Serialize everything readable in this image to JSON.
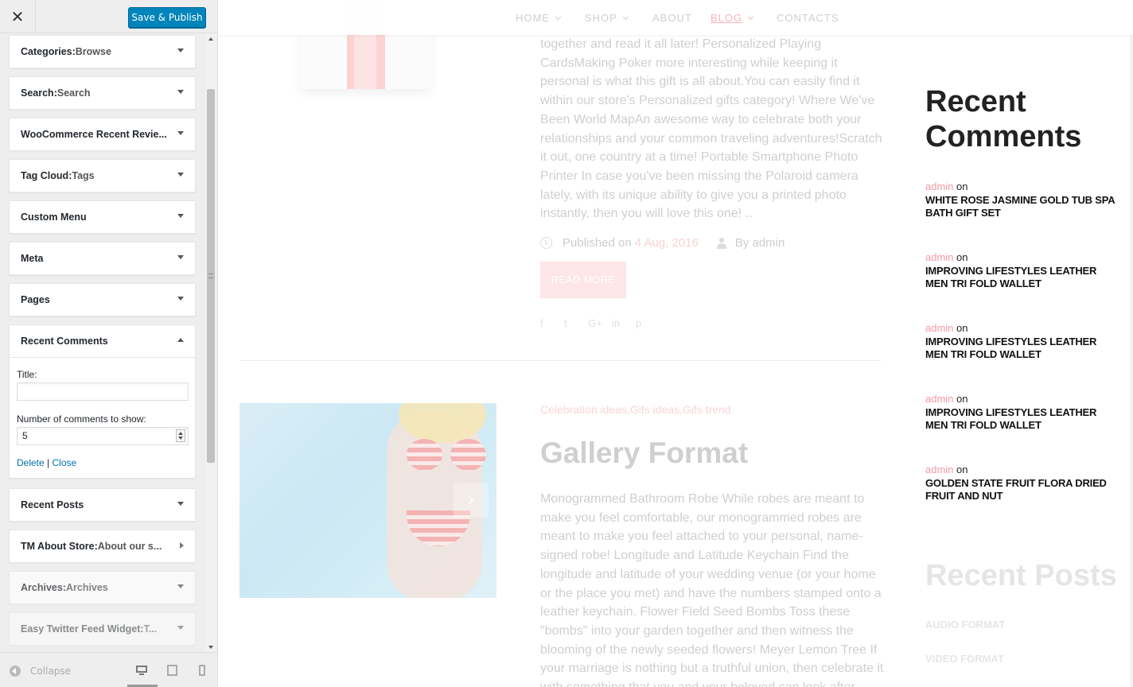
{
  "customizer": {
    "close_icon": "close-icon",
    "close_glyph": "✕",
    "save_label": "Save & Publish",
    "widgets": [
      {
        "title": "Categories",
        "sub": "Browse"
      },
      {
        "title": "Search",
        "sub": "Search"
      },
      {
        "title": "WooCommerce Recent Revie...",
        "sub": ""
      },
      {
        "title": "Tag Cloud",
        "sub": "Tags"
      },
      {
        "title": "Custom Menu",
        "sub": ""
      },
      {
        "title": "Meta",
        "sub": ""
      },
      {
        "title": "Pages",
        "sub": ""
      },
      {
        "title": "Recent Comments",
        "sub": ""
      },
      {
        "title": "Recent Posts",
        "sub": ""
      },
      {
        "title": "TM About Store",
        "sub": "About our s..."
      },
      {
        "title": "Archives",
        "sub": "Archives"
      },
      {
        "title": "Easy Twitter Feed Widget",
        "sub": "T..."
      }
    ],
    "sep": ": ",
    "expanded": {
      "title_label": "Title:",
      "title_value": "",
      "count_label": "Number of comments to show:",
      "count_value": "5",
      "delete_label": "Delete",
      "pipe": "|",
      "close_label": "Close"
    },
    "footer": {
      "collapse_label": "Collapse"
    }
  },
  "preview": {
    "nav": [
      "HOME",
      "SHOP",
      "ABOUT",
      "BLOG",
      "CONTACTS"
    ],
    "post1": {
      "excerpt": "together and read it all later! Personalized Playing CardsMaking Poker more interesting while keeping it personal is what this gift is all about.You can easily find it within our store's Personalized gifts category! Where We've Been World MapAn awesome way to celebrate both your relationships and your common traveling adventures!Scratch it out, one country at a time! Portable Smartphone Photo Printer In case you've been missing the Polaroid camera lately, with its unique ability to give you a printed photo instantly, then you will love this one! ..",
      "published_prefix": "Published on",
      "date": "4 Aug, 2016",
      "by_author": "By admin",
      "read_more": "READ MORE",
      "share": [
        "f",
        "t",
        "G+",
        "in",
        "p"
      ]
    },
    "post2": {
      "categories": "Celebration ideas,Gifs ideas,Gifs trend",
      "title": "Gallery Format",
      "excerpt": " Monogrammed Bathroom Robe While robes are meant to make you feel comfortable, our monogrammed robes are meant to make you feel attached to your personal, name-signed robe!  Longitude and Latitude Keychain Find the longitude and latitude of your wedding venue (or your home or the place you met) and have the numbers stamped onto a leather keychain.  Flower Field Seed Bombs Toss these \"bombs\" into your garden together and then witness the blooming of the newly seeded flowers!  Meyer Lemon Tree If your marriage is nothing but a truthful union, then celebrate it with something that you and your beloved can look after"
    },
    "recent_comments": {
      "title": "Recent Comments",
      "items": [
        {
          "author": "admin",
          "on": "on",
          "post": "WHITE ROSE JASMINE GOLD TUB SPA BATH GIFT SET"
        },
        {
          "author": "admin",
          "on": "on",
          "post": "IMPROVING LIFESTYLES LEATHER MEN TRI FOLD WALLET"
        },
        {
          "author": "admin",
          "on": "on",
          "post": "IMPROVING LIFESTYLES LEATHER MEN TRI FOLD WALLET"
        },
        {
          "author": "admin",
          "on": "on",
          "post": "IMPROVING LIFESTYLES LEATHER MEN TRI FOLD WALLET"
        },
        {
          "author": "admin",
          "on": "on",
          "post": "GOLDEN STATE FRUIT FLORA DRIED FRUIT AND NUT"
        }
      ]
    },
    "recent_posts": {
      "title": "Recent Posts",
      "items": [
        "AUDIO FORMAT",
        "VIDEO FORMAT"
      ]
    }
  }
}
